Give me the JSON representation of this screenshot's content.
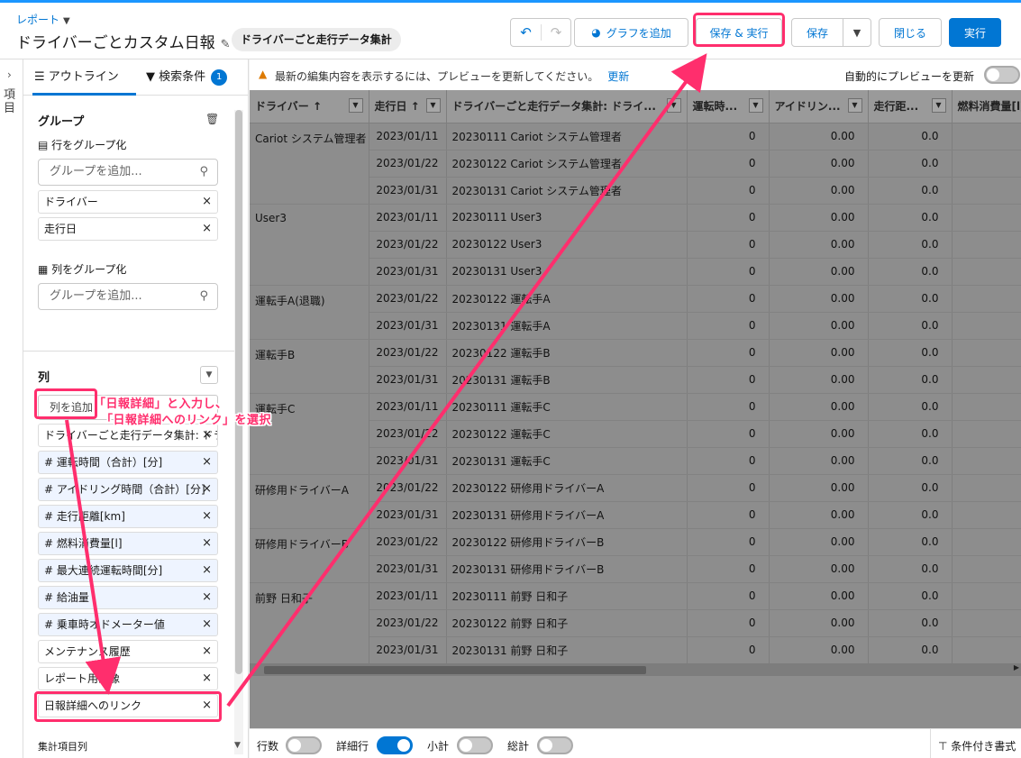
{
  "header": {
    "breadcrumb": "レポート",
    "title": "ドライバーごとカスタム日報",
    "report_type": "ドライバーごと走行データ集計",
    "undo": "↶",
    "redo": "↷",
    "add_chart": "グラフを追加",
    "save_run": "保存 & 実行",
    "save": "保存",
    "close": "閉じる",
    "run": "実行"
  },
  "side_strip": {
    "label": "項目"
  },
  "panel": {
    "tabs": {
      "outline": "アウトライン",
      "filters": "検索条件",
      "filters_count": "1"
    },
    "group_title": "グループ",
    "row_group_label": "行をグループ化",
    "group_placeholder": "グループを追加...",
    "row_groups": [
      "ドライバー",
      "走行日"
    ],
    "col_group_label": "列をグループ化",
    "columns_title": "列",
    "add_column": "列を追加",
    "columns": [
      "ドライバーごと走行データ集計: ドライバー",
      "# 運転時間（合計）[分]",
      "# アイドリング時間（合計）[分]",
      "# 走行距離[km]",
      "# 燃料消費量[l]",
      "# 最大連続運転時間[分]",
      "# 給油量",
      "# 乗車時オドメーター値",
      "メンテナンス履歴",
      "レポート用画像",
      "日報詳細へのリンク"
    ],
    "summary_label": "集計項目列"
  },
  "annotation": {
    "line1": "「日報詳細」と入力し、",
    "line2": "「日報詳細へのリンク」を選択"
  },
  "notice": {
    "message": "最新の編集内容を表示するには、プレビューを更新してください。",
    "refresh_link": "更新",
    "auto_preview": "自動的にプレビューを更新"
  },
  "table": {
    "headers": [
      "ドライバー ↑",
      "走行日 ↑",
      "ドライバーごと走行データ集計: ドライ...",
      "運転時...",
      "アイドリン...",
      "走行距...",
      "燃料消費量[l]"
    ],
    "groups": [
      {
        "driver": "Cariot システム管理者",
        "rows": [
          [
            "2023/01/11",
            "20230111 Cariot システム管理者",
            "0",
            "0.00",
            "0.0"
          ],
          [
            "2023/01/22",
            "20230122 Cariot システム管理者",
            "0",
            "0.00",
            "0.0"
          ],
          [
            "2023/01/31",
            "20230131 Cariot システム管理者",
            "0",
            "0.00",
            "0.0"
          ]
        ]
      },
      {
        "driver": "User3",
        "rows": [
          [
            "2023/01/11",
            "20230111 User3",
            "0",
            "0.00",
            "0.0"
          ],
          [
            "2023/01/22",
            "20230122 User3",
            "0",
            "0.00",
            "0.0"
          ],
          [
            "2023/01/31",
            "20230131 User3",
            "0",
            "0.00",
            "0.0"
          ]
        ]
      },
      {
        "driver": "運転手A(退職)",
        "rows": [
          [
            "2023/01/22",
            "20230122 運転手A",
            "0",
            "0.00",
            "0.0"
          ],
          [
            "2023/01/31",
            "20230131 運転手A",
            "0",
            "0.00",
            "0.0"
          ]
        ]
      },
      {
        "driver": "運転手B",
        "rows": [
          [
            "2023/01/22",
            "20230122 運転手B",
            "0",
            "0.00",
            "0.0"
          ],
          [
            "2023/01/31",
            "20230131 運転手B",
            "0",
            "0.00",
            "0.0"
          ]
        ]
      },
      {
        "driver": "運転手C",
        "rows": [
          [
            "2023/01/11",
            "20230111 運転手C",
            "0",
            "0.00",
            "0.0"
          ],
          [
            "2023/01/22",
            "20230122 運転手C",
            "0",
            "0.00",
            "0.0"
          ],
          [
            "2023/01/31",
            "20230131 運転手C",
            "0",
            "0.00",
            "0.0"
          ]
        ]
      },
      {
        "driver": "研修用ドライバーA",
        "rows": [
          [
            "2023/01/22",
            "20230122 研修用ドライバーA",
            "0",
            "0.00",
            "0.0"
          ],
          [
            "2023/01/31",
            "20230131 研修用ドライバーA",
            "0",
            "0.00",
            "0.0"
          ]
        ]
      },
      {
        "driver": "研修用ドライバーB",
        "rows": [
          [
            "2023/01/22",
            "20230122 研修用ドライバーB",
            "0",
            "0.00",
            "0.0"
          ],
          [
            "2023/01/31",
            "20230131 研修用ドライバーB",
            "0",
            "0.00",
            "0.0"
          ]
        ]
      },
      {
        "driver": "前野 日和子",
        "rows": [
          [
            "2023/01/11",
            "20230111 前野 日和子",
            "0",
            "0.00",
            "0.0"
          ],
          [
            "2023/01/22",
            "20230122 前野 日和子",
            "0",
            "0.00",
            "0.0"
          ],
          [
            "2023/01/31",
            "20230131 前野 日和子",
            "0",
            "0.00",
            "0.0"
          ]
        ]
      }
    ]
  },
  "bottom": {
    "row_count": "行数",
    "detail_rows": "詳細行",
    "subtotal": "小計",
    "grand_total": "総計",
    "conditional_format": "条件付き書式"
  },
  "colors": {
    "accent": "#0176d3",
    "highlight": "#ff2e6d"
  }
}
